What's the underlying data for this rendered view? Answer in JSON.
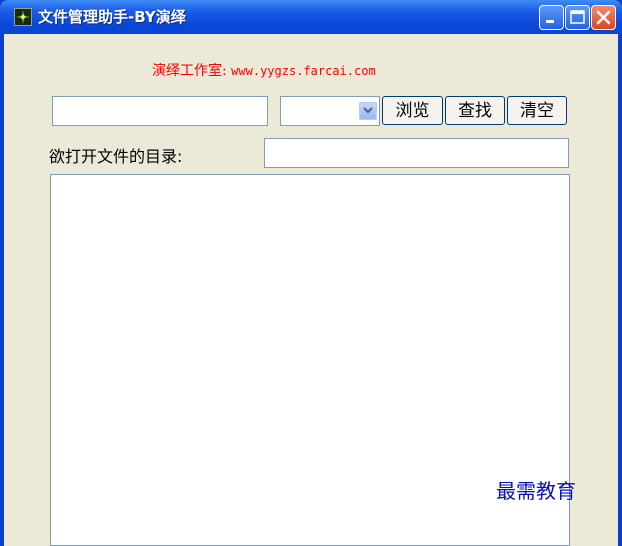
{
  "window": {
    "title": "文件管理助手-BY演绎",
    "colors": {
      "titlebar": "#0a45d0",
      "client": "#ece9d8",
      "header_text": "#ff0000",
      "watermark": "#0a10b8"
    }
  },
  "header": {
    "studio": "演绎工作室:",
    "url": "www.yygzs.farcai.com"
  },
  "toolbar": {
    "path_input_value": "",
    "combo_selected": "",
    "browse_label": "浏览",
    "search_label": "查找",
    "clear_label": "清空"
  },
  "dir_row": {
    "label": "欲打开文件的目录:",
    "input_value": ""
  },
  "watermark": "最需教育",
  "icons": [
    "app-icon",
    "minimize-icon",
    "maximize-icon",
    "close-icon",
    "chevron-down-icon"
  ]
}
